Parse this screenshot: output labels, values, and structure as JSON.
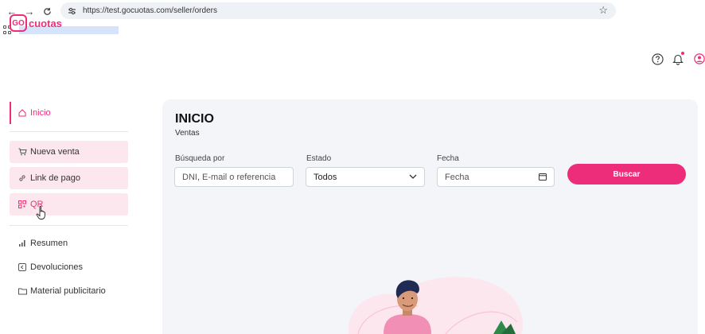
{
  "browser": {
    "url": "https://test.gocuotas.com/seller/orders"
  },
  "logo": {
    "badge": "GO",
    "text": "cuotas"
  },
  "sidebar": {
    "items": [
      {
        "label": "Inicio",
        "icon": "home-icon"
      },
      {
        "label": "Nueva venta",
        "icon": "cart-icon"
      },
      {
        "label": "Link de pago",
        "icon": "link-icon"
      },
      {
        "label": "QR",
        "icon": "qr-icon"
      },
      {
        "label": "Resumen",
        "icon": "bar-chart-icon"
      },
      {
        "label": "Devoluciones",
        "icon": "return-icon"
      },
      {
        "label": "Material publicitario",
        "icon": "folder-icon"
      }
    ]
  },
  "header": {
    "icons": [
      "help-icon",
      "bell-icon",
      "user-icon"
    ]
  },
  "main": {
    "title": "INICIO",
    "subtitle": "Ventas",
    "search": {
      "label": "Búsqueda por",
      "placeholder": "DNI, E-mail o referencia"
    },
    "status": {
      "label": "Estado",
      "value": "Todos"
    },
    "date": {
      "label": "Fecha",
      "placeholder": "Fecha"
    },
    "search_button": "Buscar"
  },
  "colors": {
    "brand": "#ee2d7a",
    "active_bg": "#fde7ef",
    "panel_bg": "#f4f5f8"
  }
}
